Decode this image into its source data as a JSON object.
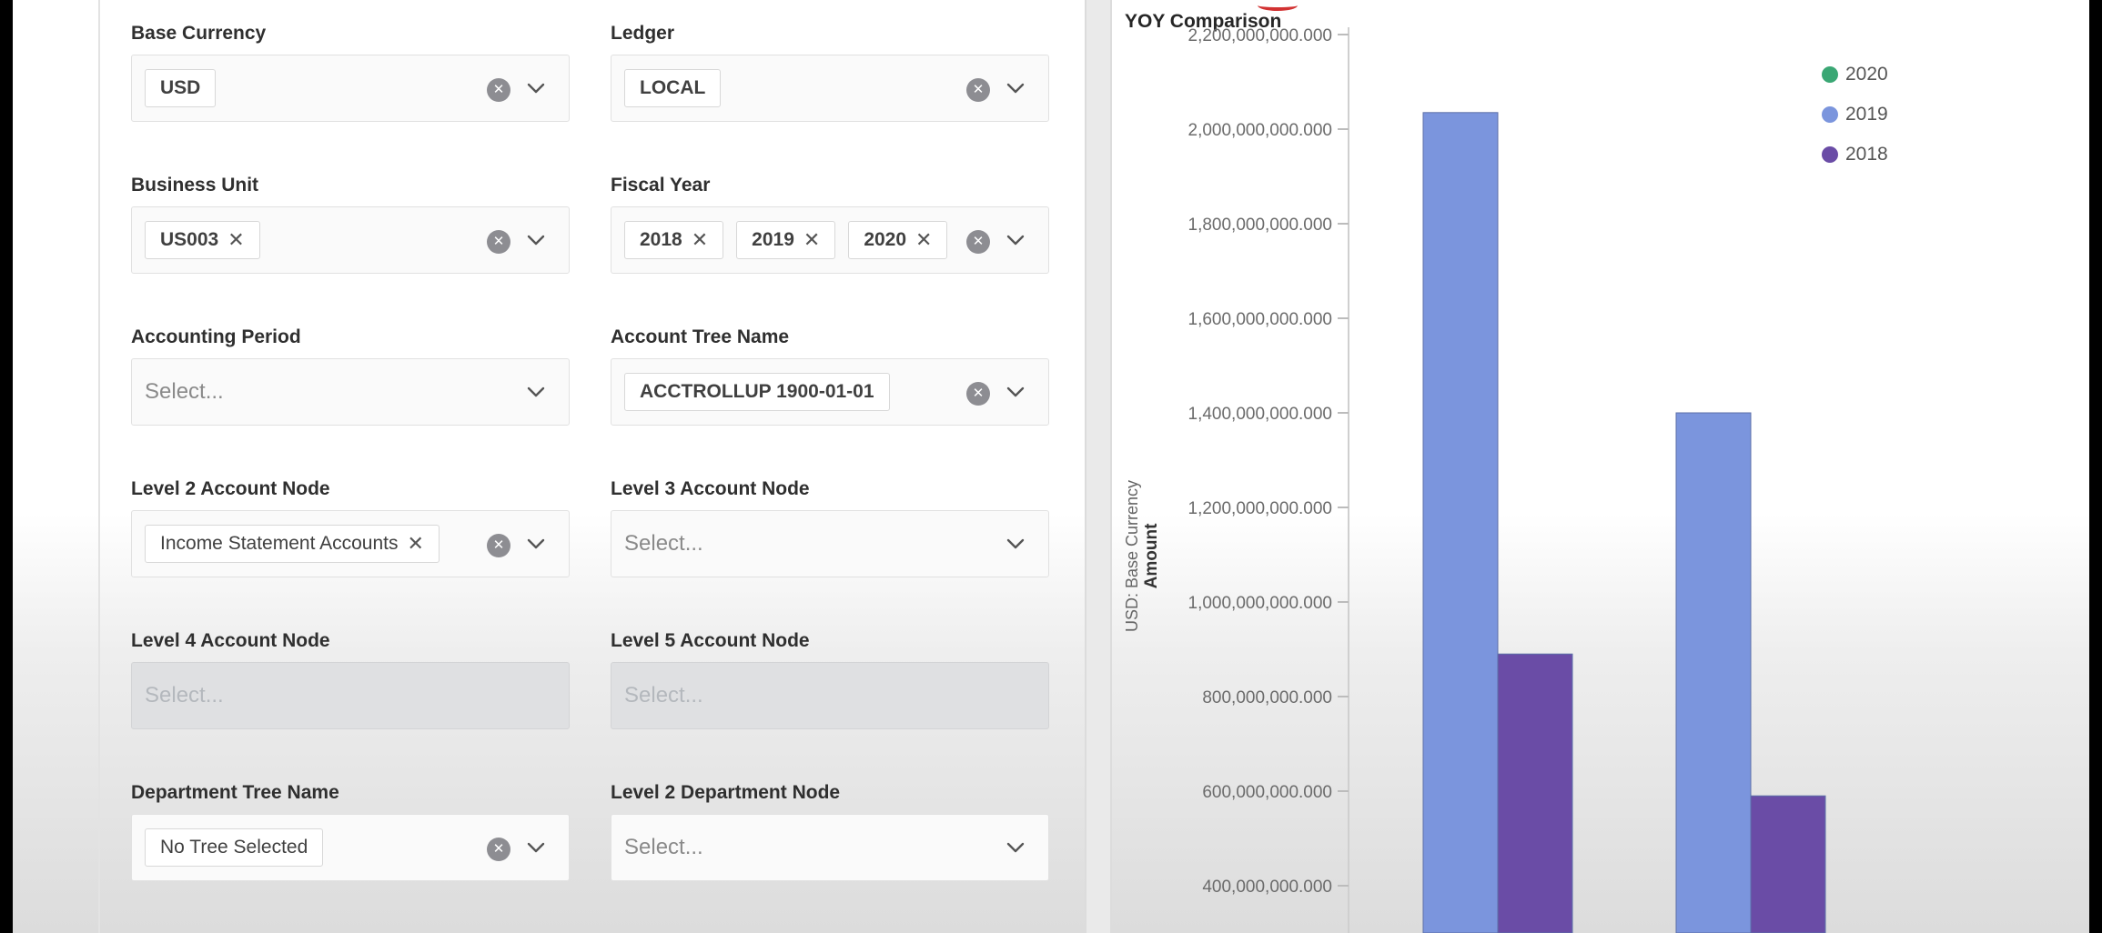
{
  "filters": {
    "base_currency": {
      "label": "Base Currency",
      "chips": [
        "USD"
      ]
    },
    "ledger": {
      "label": "Ledger",
      "chips": [
        "LOCAL"
      ]
    },
    "business_unit": {
      "label": "Business Unit",
      "chips": [
        "US003"
      ]
    },
    "fiscal_year": {
      "label": "Fiscal Year",
      "chips": [
        "2018",
        "2019",
        "2020"
      ]
    },
    "accounting_period": {
      "label": "Accounting Period",
      "placeholder": "Select..."
    },
    "account_tree_name": {
      "label": "Account Tree Name",
      "chips": [
        "ACCTROLLUP 1900-01-01"
      ]
    },
    "level2_account_node": {
      "label": "Level 2 Account Node",
      "chips": [
        "Income Statement Accounts"
      ]
    },
    "level3_account_node": {
      "label": "Level 3 Account Node",
      "placeholder": "Select..."
    },
    "level4_account_node": {
      "label": "Level 4 Account Node",
      "placeholder": "Select...",
      "disabled": true
    },
    "level5_account_node": {
      "label": "Level 5 Account Node",
      "placeholder": "Select...",
      "disabled": true
    },
    "department_tree_name": {
      "label": "Department Tree Name",
      "chips": [
        "No Tree Selected"
      ]
    },
    "level2_department_node": {
      "label": "Level 2 Department Node",
      "placeholder": "Select..."
    }
  },
  "icons": {
    "chip_remove": "close-icon",
    "clear": "clear-circle-icon",
    "dropdown": "chevron-down-icon"
  },
  "chart_data": {
    "type": "bar",
    "title": "YOY Comparison",
    "ylabel": "Amount",
    "ylabel_unit": "USD: Base Currency",
    "ylim": [
      300000000000,
      2200000000000
    ],
    "yticks": [
      400000000000,
      600000000000,
      800000000000,
      1000000000000,
      1200000000000,
      1400000000000,
      1600000000000,
      1800000000000,
      2000000000000,
      2200000000000
    ],
    "ytick_labels": [
      "400,000,000.000",
      "600,000,000.000",
      "800,000,000.000",
      "1,000,000,000.000",
      "1,200,000,000.000",
      "1,400,000,000.000",
      "1,600,000,000.000",
      "1,800,000,000.000",
      "2,000,000,000.000",
      "2,200,000,000.000"
    ],
    "legend_position": "top-right",
    "series": [
      {
        "name": "2020",
        "color": "#3aa774",
        "values": [
          null,
          null
        ]
      },
      {
        "name": "2019",
        "color": "#7b95dd",
        "values": [
          2035000000000,
          1400000000000
        ]
      },
      {
        "name": "2018",
        "color": "#6a4ca6",
        "values": [
          890000000000,
          590000000000
        ]
      }
    ],
    "grid": false
  }
}
